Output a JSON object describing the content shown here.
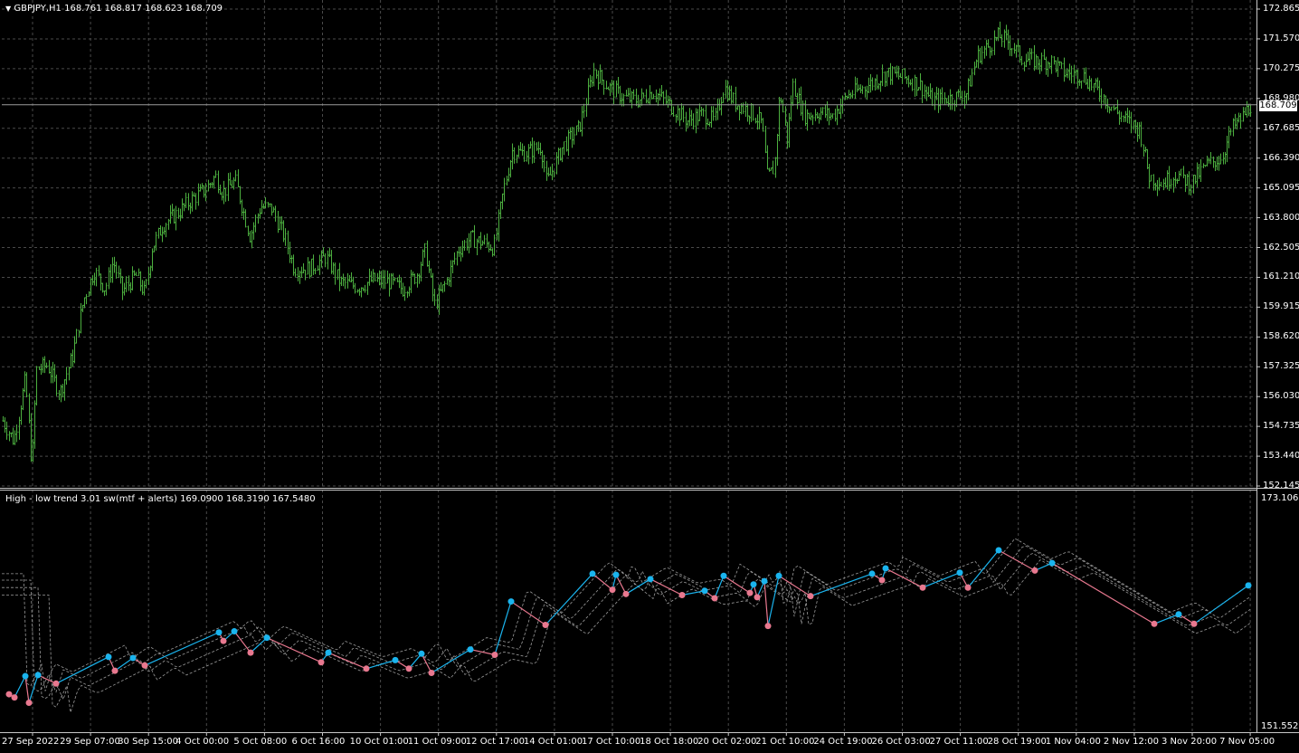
{
  "main": {
    "title": "GBPJPY,H1  168.761 168.817 168.623 168.709",
    "current_price": "168.709",
    "price_labels": [
      "172.865",
      "171.570",
      "170.275",
      "168.980",
      "167.685",
      "166.390",
      "165.095",
      "163.800",
      "162.505",
      "161.210",
      "159.915",
      "158.620",
      "157.325",
      "156.030",
      "154.735",
      "153.440",
      "152.145"
    ]
  },
  "indicator": {
    "title": "High - low trend 3.01 sw(mtf + alerts) 169.0900 168.3190 167.5480",
    "top_label": "173.1065",
    "bottom_label": "151.5525"
  },
  "time_labels": [
    "27 Sep 2022",
    "29 Sep 07:00",
    "30 Sep 15:00",
    "4 Oct 00:00",
    "5 Oct 08:00",
    "6 Oct 16:00",
    "10 Oct 01:00",
    "11 Oct 09:00",
    "12 Oct 17:00",
    "14 Oct 01:00",
    "17 Oct 10:00",
    "18 Oct 18:00",
    "20 Oct 02:00",
    "21 Oct 10:00",
    "24 Oct 19:00",
    "26 Oct 03:00",
    "27 Oct 11:00",
    "28 Oct 19:00",
    "1 Nov 04:00",
    "2 Nov 12:00",
    "3 Nov 20:00",
    "7 Nov 05:00"
  ],
  "colors": {
    "background": "#000000",
    "candles": "#4caf3f",
    "grid": "#4a4a4a",
    "swing_high": "#1ab4ee",
    "swing_low": "#e8788f",
    "bands": "#9a9a9a"
  },
  "chart_data": {
    "type": "line",
    "price_path": [
      [
        0,
        155.2
      ],
      [
        15,
        154.1
      ],
      [
        28,
        156.8
      ],
      [
        35,
        152.9
      ],
      [
        40,
        157.2
      ],
      [
        52,
        157.4
      ],
      [
        66,
        156.2
      ],
      [
        80,
        157.8
      ],
      [
        92,
        160.2
      ],
      [
        104,
        161.5
      ],
      [
        116,
        160.7
      ],
      [
        125,
        161.9
      ],
      [
        135,
        160.6
      ],
      [
        150,
        161.3
      ],
      [
        160,
        160.5
      ],
      [
        168,
        162.5
      ],
      [
        180,
        163.5
      ],
      [
        196,
        164.0
      ],
      [
        212,
        164.6
      ],
      [
        226,
        165.0
      ],
      [
        238,
        165.6
      ],
      [
        246,
        164.9
      ],
      [
        260,
        165.4
      ],
      [
        276,
        163.0
      ],
      [
        288,
        164.3
      ],
      [
        300,
        164.2
      ],
      [
        314,
        163.0
      ],
      [
        325,
        161.6
      ],
      [
        342,
        161.6
      ],
      [
        360,
        162.1
      ],
      [
        376,
        161.0
      ],
      [
        396,
        160.8
      ],
      [
        412,
        161.1
      ],
      [
        430,
        161.0
      ],
      [
        445,
        160.7
      ],
      [
        460,
        161.3
      ],
      [
        470,
        162.4
      ],
      [
        480,
        160.0
      ],
      [
        493,
        161.0
      ],
      [
        506,
        162.4
      ],
      [
        520,
        162.9
      ],
      [
        535,
        162.7
      ],
      [
        546,
        162.5
      ],
      [
        556,
        164.9
      ],
      [
        566,
        166.7
      ],
      [
        580,
        166.6
      ],
      [
        598,
        166.9
      ],
      [
        604,
        165.3
      ],
      [
        622,
        166.9
      ],
      [
        640,
        167.7
      ],
      [
        656,
        170.2
      ],
      [
        672,
        169.5
      ],
      [
        690,
        169.0
      ],
      [
        706,
        168.9
      ],
      [
        722,
        169.3
      ],
      [
        740,
        168.7
      ],
      [
        760,
        168.0
      ],
      [
        776,
        168.3
      ],
      [
        790,
        168.0
      ],
      [
        800,
        169.5
      ],
      [
        812,
        168.8
      ],
      [
        830,
        168.4
      ],
      [
        842,
        167.9
      ],
      [
        848,
        165.5
      ],
      [
        856,
        166.0
      ],
      [
        862,
        169.3
      ],
      [
        870,
        167.2
      ],
      [
        876,
        169.6
      ],
      [
        890,
        168.2
      ],
      [
        906,
        168.4
      ],
      [
        920,
        168.2
      ],
      [
        936,
        169.1
      ],
      [
        952,
        169.4
      ],
      [
        970,
        169.8
      ],
      [
        980,
        170.1
      ],
      [
        998,
        169.9
      ],
      [
        1016,
        169.6
      ],
      [
        1030,
        168.9
      ],
      [
        1052,
        169.0
      ],
      [
        1068,
        169.2
      ],
      [
        1080,
        170.8
      ],
      [
        1094,
        171.3
      ],
      [
        1104,
        171.7
      ],
      [
        1116,
        171.4
      ],
      [
        1130,
        170.7
      ],
      [
        1146,
        170.6
      ],
      [
        1162,
        170.6
      ],
      [
        1176,
        170.1
      ],
      [
        1196,
        170.0
      ],
      [
        1216,
        169.2
      ],
      [
        1236,
        168.3
      ],
      [
        1260,
        167.6
      ],
      [
        1270,
        165.6
      ],
      [
        1284,
        165.3
      ],
      [
        1300,
        165.7
      ],
      [
        1316,
        165.3
      ],
      [
        1334,
        166.1
      ],
      [
        1350,
        166.4
      ],
      [
        1362,
        167.7
      ],
      [
        1372,
        168.1
      ],
      [
        1382,
        168.7
      ]
    ],
    "swing_points": [
      [
        10,
        154.6,
        "low"
      ],
      [
        16,
        154.3,
        "low"
      ],
      [
        28,
        156.3,
        "high"
      ],
      [
        32,
        153.8,
        "low"
      ],
      [
        42,
        156.4,
        "high"
      ],
      [
        62,
        155.6,
        "low"
      ],
      [
        120,
        158.1,
        "high"
      ],
      [
        127,
        156.8,
        "low"
      ],
      [
        147,
        158.0,
        "high"
      ],
      [
        160,
        157.3,
        "low"
      ],
      [
        242,
        160.4,
        "high"
      ],
      [
        247,
        159.6,
        "low"
      ],
      [
        259,
        160.5,
        "high"
      ],
      [
        277,
        158.5,
        "low"
      ],
      [
        295,
        159.9,
        "high"
      ],
      [
        355,
        157.6,
        "low"
      ],
      [
        363,
        158.5,
        "high"
      ],
      [
        405,
        157.0,
        "low"
      ],
      [
        437,
        157.8,
        "high"
      ],
      [
        452,
        157.0,
        "low"
      ],
      [
        466,
        158.4,
        "high"
      ],
      [
        477,
        156.6,
        "low"
      ],
      [
        520,
        158.8,
        "high"
      ],
      [
        547,
        158.3,
        "low"
      ],
      [
        565,
        163.3,
        "high"
      ],
      [
        603,
        161.1,
        "low"
      ],
      [
        655,
        165.9,
        "high"
      ],
      [
        677,
        164.4,
        "low"
      ],
      [
        681,
        165.8,
        "high"
      ],
      [
        692,
        164.0,
        "low"
      ],
      [
        719,
        165.4,
        "high"
      ],
      [
        754,
        163.9,
        "low"
      ],
      [
        779,
        164.3,
        "high"
      ],
      [
        790,
        163.6,
        "low"
      ],
      [
        800,
        165.7,
        "high"
      ],
      [
        829,
        164.1,
        "low"
      ],
      [
        833,
        164.9,
        "high"
      ],
      [
        837,
        163.7,
        "low"
      ],
      [
        845,
        165.2,
        "high"
      ],
      [
        849,
        161.0,
        "low"
      ],
      [
        861,
        165.7,
        "high"
      ],
      [
        896,
        163.8,
        "low"
      ],
      [
        964,
        165.9,
        "high"
      ],
      [
        975,
        165.3,
        "low"
      ],
      [
        979,
        166.4,
        "high"
      ],
      [
        1020,
        164.6,
        "low"
      ],
      [
        1061,
        166.0,
        "high"
      ],
      [
        1070,
        164.6,
        "low"
      ],
      [
        1104,
        168.1,
        "high"
      ],
      [
        1144,
        166.2,
        "low"
      ],
      [
        1163,
        166.9,
        "high"
      ],
      [
        1276,
        161.2,
        "low"
      ],
      [
        1303,
        162.1,
        "high"
      ],
      [
        1320,
        161.2,
        "low"
      ],
      [
        1380,
        164.8,
        "high"
      ]
    ]
  }
}
